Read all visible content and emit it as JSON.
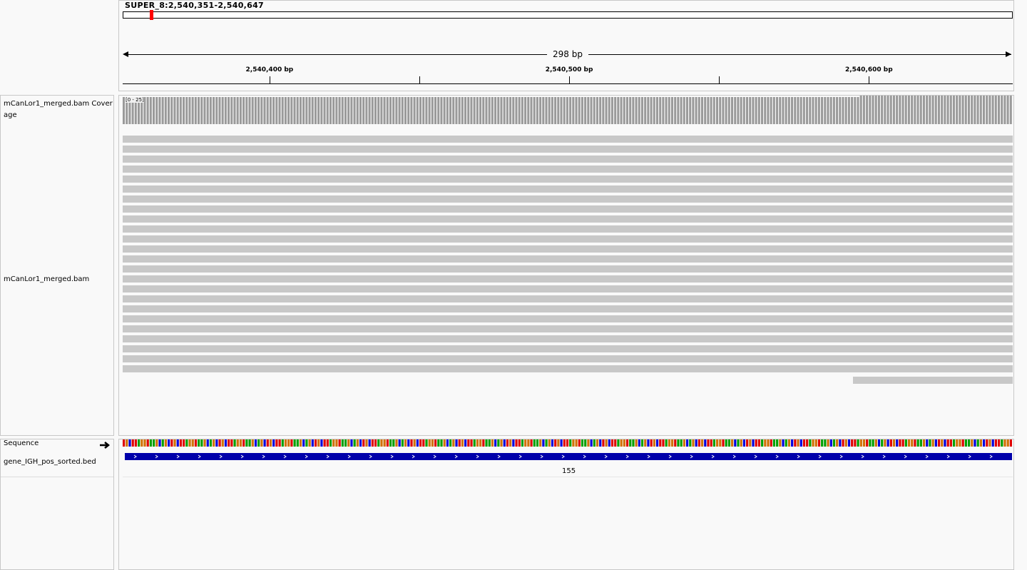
{
  "header": {
    "locus": "SUPER_8:2,540,351-2,540,647",
    "range_width": "298 bp",
    "ticks": [
      {
        "label": "2,540,400 bp",
        "pos": 2540400
      },
      {
        "label": "2,540,500 bp",
        "pos": 2540500
      },
      {
        "label": "2,540,600 bp",
        "pos": 2540600
      }
    ],
    "minor_ticks": [
      2540450,
      2540550
    ]
  },
  "tracks": {
    "coverage_name": "mCanLor1_merged.bam Coverage",
    "coverage_range": "[0 - 25]",
    "alignment_name": "mCanLor1_merged.bam",
    "sequence_name": "Sequence",
    "bed_name": "gene_IGH_pos_sorted.bed",
    "feature_label": "155"
  },
  "colors": {
    "coverage": "#9a9a9a",
    "read": "#c8c8c8",
    "feature": "#0000aa",
    "A": "#00a000",
    "C": "#0000e0",
    "G": "#d17105",
    "T": "#e00000",
    "cytoband_marker": "#ff0000"
  },
  "icons": {
    "strand": "arrow-right-icon"
  }
}
